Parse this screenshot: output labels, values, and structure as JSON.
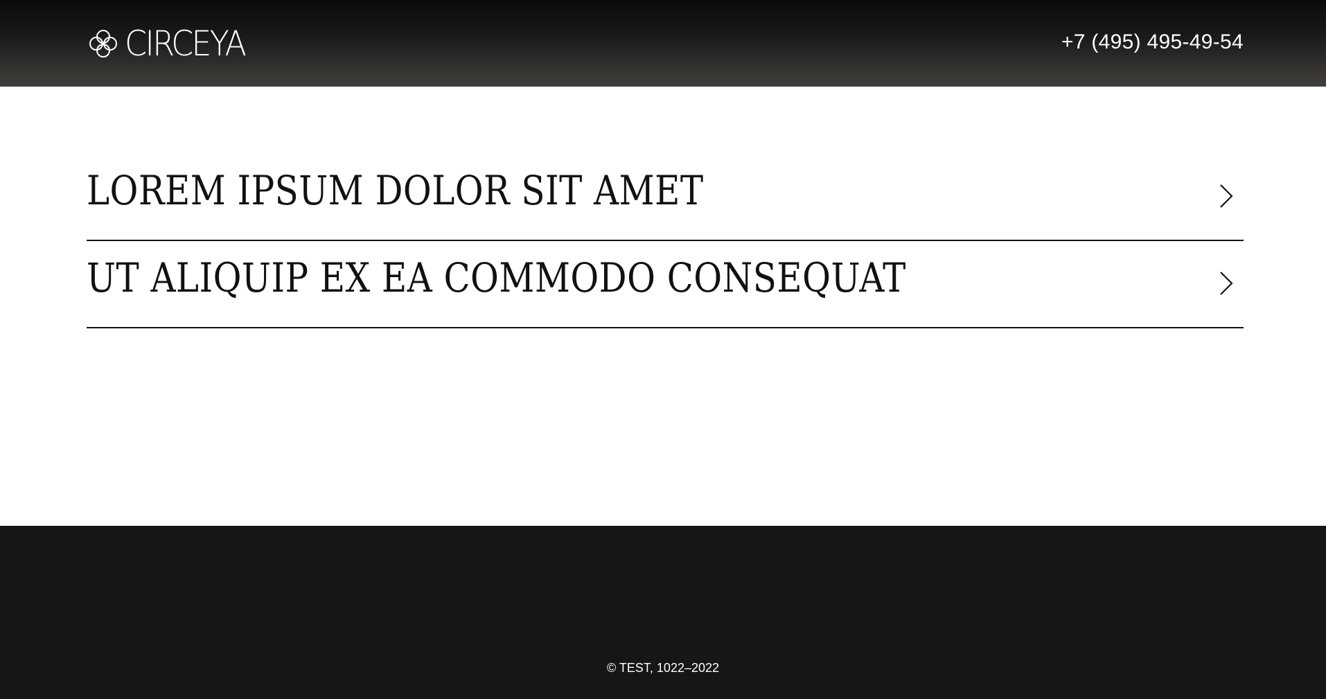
{
  "header": {
    "logo_text": "CIRCEYA",
    "logo_icon": "four-petal-flower-icon",
    "phone": "+7 (495) 495-49-54"
  },
  "main": {
    "items": [
      {
        "label": "LOREM IPSUM DOLOR SIT AMET",
        "icon": "chevron-right-icon"
      },
      {
        "label": "UT ALIQUIP EX EA COMMODO CONSEQUAT",
        "icon": "chevron-right-icon"
      }
    ]
  },
  "footer": {
    "copyright": "© TEST, 1022–2022"
  },
  "colors": {
    "header_top": "#0a0a0a",
    "header_bottom": "#43403d",
    "text_dark": "#111111",
    "footer_bg": "#161616",
    "text_light": "#ffffff"
  }
}
